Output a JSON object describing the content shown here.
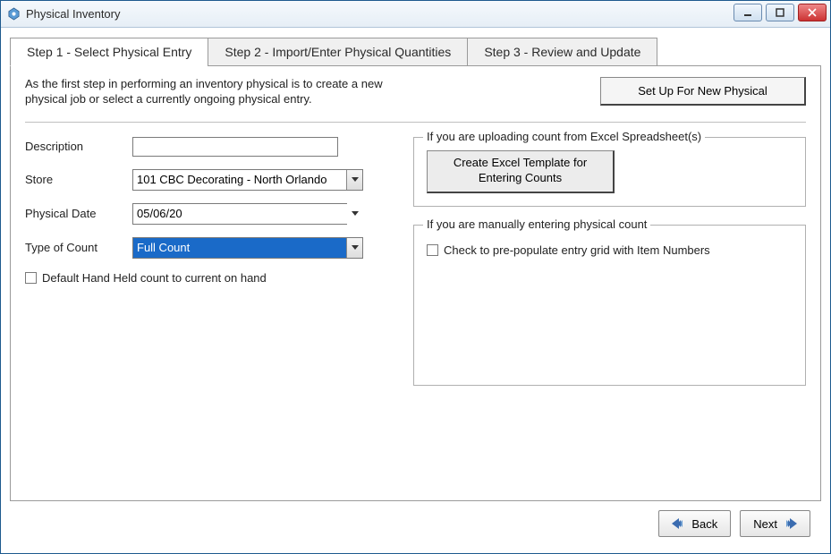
{
  "window": {
    "title": "Physical Inventory"
  },
  "tabs": [
    {
      "label": "Step 1 - Select Physical Entry",
      "active": true
    },
    {
      "label": "Step 2 - Import/Enter Physical Quantities",
      "active": false
    },
    {
      "label": "Step 3 - Review and Update",
      "active": false
    }
  ],
  "intro": "As the first step in performing an inventory physical is to create a new physical job or select a currently ongoing physical entry.",
  "buttons": {
    "setup_new_physical": "Set Up For New Physical",
    "create_excel_template": "Create Excel Template for Entering Counts",
    "back": "Back",
    "next": "Next"
  },
  "form": {
    "description_label": "Description",
    "description_value": "",
    "store_label": "Store",
    "store_value": "101 CBC Decorating - North Orlando",
    "physical_date_label": "Physical Date",
    "physical_date_value": "05/06/20",
    "type_of_count_label": "Type of Count",
    "type_of_count_value": "Full Count",
    "default_hh_label": "Default Hand Held count to current on hand",
    "default_hh_checked": false
  },
  "groups": {
    "upload_excel_legend": "If you are uploading count from Excel Spreadsheet(s)",
    "manual_entry_legend": "If you are manually entering physical count",
    "prepopulate_label": "Check to pre-populate entry grid with Item Numbers",
    "prepopulate_checked": false
  }
}
